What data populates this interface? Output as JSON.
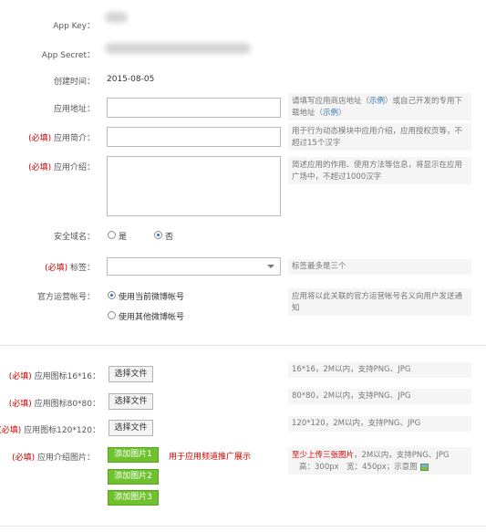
{
  "form": {
    "app_key": {
      "label": "App Key："
    },
    "app_secret": {
      "label": "App Secret："
    },
    "created": {
      "label": "创建时间：",
      "value": "2015-08-05"
    },
    "app_url": {
      "label": "应用地址：",
      "value": "",
      "hint_a": "请填写应用商店地址（",
      "hint_link1": "示例",
      "hint_b": "）或自己开发的专用下载地址（",
      "hint_link2": "示例",
      "hint_c": "）"
    },
    "summary": {
      "required": "(必填)",
      "label": " 应用简介：",
      "value": "",
      "hint": "用于行为动态模块中应用介绍，应用授权页等，不超过15个汉字"
    },
    "intro": {
      "required": "(必填)",
      "label": " 应用介绍：",
      "value": "",
      "hint": "简述应用的作用、使用方法等信息，将显示在应用广场中，不超过1000汉字"
    },
    "domain": {
      "label": "安全域名：",
      "options": [
        "是",
        "否"
      ],
      "selected": "否"
    },
    "tags": {
      "required": "(必填)",
      "label": " 标签：",
      "value": "",
      "hint": "标签最多是三个"
    },
    "official_account": {
      "label": "官方运营帐号：",
      "options": [
        "使用当前微博帐号",
        "使用其他微博帐号"
      ],
      "selected": "使用当前微博帐号",
      "hint": "应用将以此关联的官方运营帐号名义向用户发送通知"
    },
    "icon16": {
      "required": "(必填)",
      "label": " 应用图标16*16：",
      "button": "选择文件",
      "hint": "16*16，2M以内，支持PNG、JPG"
    },
    "icon80": {
      "required": "(必填)",
      "label": " 应用图标80*80：",
      "button": "选择文件",
      "hint": "80*80，2M以内，支持PNG、JPG"
    },
    "icon120": {
      "required": "(必填)",
      "label": " 应用图标120*120：",
      "button": "选择文件",
      "hint": "120*120，2M以内，支持PNG、JPG"
    },
    "intro_images": {
      "required": "(必填)",
      "label": " 应用介绍图片：",
      "buttons": [
        "添加图片1",
        "添加图片2",
        "添加图片3"
      ],
      "note": "用于应用频道推广展示",
      "hint_red": "至少上传三张图片",
      "hint_rest": "，2M以内，支持PNG、JPG",
      "hint_line2": "高：300px　宽：450px；示意图"
    }
  },
  "colors": {
    "required": "#cc0000",
    "accent_green": "#6fc22e",
    "link": "#2b6cb3"
  }
}
